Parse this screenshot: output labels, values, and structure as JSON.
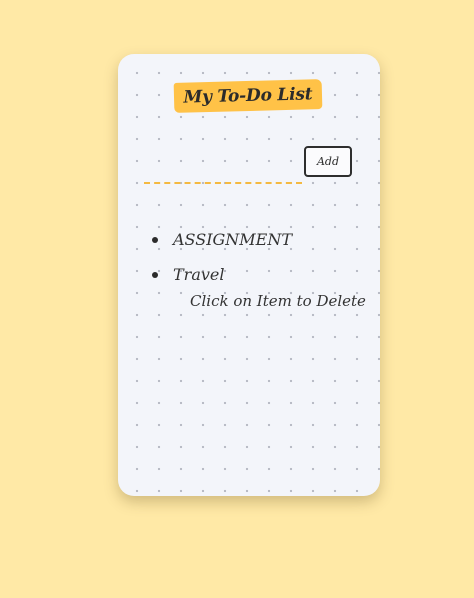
{
  "app": {
    "title": "My To-Do List"
  },
  "form": {
    "input_value": "",
    "input_placeholder": "",
    "add_label": "Add"
  },
  "todos": [
    {
      "label": "ASSIGNMENT"
    },
    {
      "label": "Travel"
    }
  ],
  "hint": "Click on Item to Delete",
  "colors": {
    "background": "#ffe9a6",
    "card": "#f3f5fa",
    "accent": "#ffc247",
    "underline": "#f4b941",
    "ink": "#2b2b2b"
  }
}
